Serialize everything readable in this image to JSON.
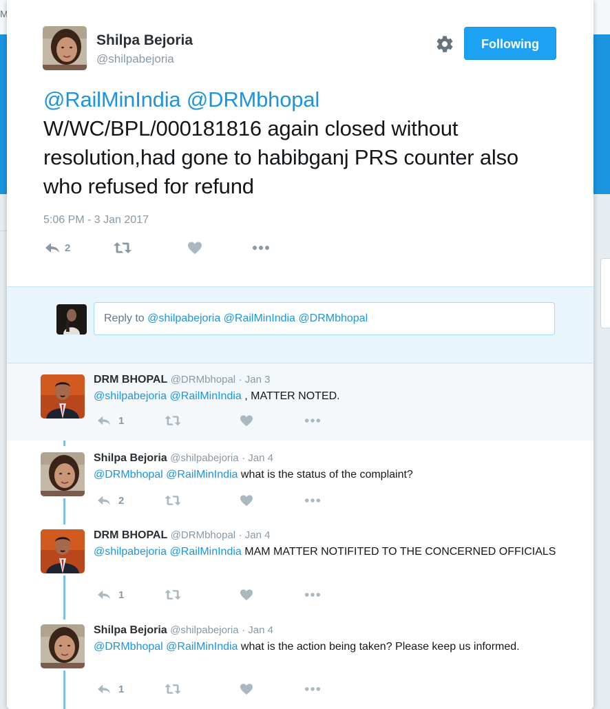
{
  "background": {
    "top_fragment": "M"
  },
  "main_tweet": {
    "author_name": "Shilpa Bejoria",
    "author_handle": "@shilpabejoria",
    "follow_label": "Following",
    "mention1": "@RailMinIndia",
    "mention2": "@DRMbhopal",
    "body": "W/WC/BPL/000181816 again closed without resolution,had gone to habibganj PRS counter also who refused for refund",
    "timestamp": "5:06 PM - 3 Jan 2017",
    "reply_count": "2"
  },
  "reply_box": {
    "prefix": "Reply to ",
    "mentions": "@shilpabejoria @RailMinIndia @DRMbhopal"
  },
  "replies": [
    {
      "name": "DRM BHOPAL",
      "handle": "@DRMbhopal",
      "date": "· Jan 3",
      "mentions": "@shilpabejoria @RailMinIndia",
      "text": " , MATTER NOTED.",
      "reply_count": "1"
    },
    {
      "name": "Shilpa Bejoria",
      "handle": "@shilpabejoria",
      "date": "· Jan 4",
      "mentions": "@DRMbhopal @RailMinIndia",
      "text": " what is the status of the complaint?",
      "reply_count": "2"
    },
    {
      "name": "DRM BHOPAL",
      "handle": "@DRMbhopal",
      "date": "· Jan 4",
      "mentions": "@shilpabejoria @RailMinIndia",
      "text": " MAM MATTER NOTIFITED TO THE CONCERNED OFFICIALS",
      "reply_count": "1"
    },
    {
      "name": "Shilpa Bejoria",
      "handle": "@shilpabejoria",
      "date": "· Jan 4",
      "mentions": "@DRMbhopal @RailMinIndia",
      "text": " what is the action being taken? Please keep us informed.",
      "reply_count": "1"
    }
  ],
  "colors": {
    "accent": "#1da1f2",
    "mention": "#1b95e0",
    "muted": "#8899a6",
    "thread_line": "#7ec0e8"
  },
  "icons": [
    "gear-icon",
    "reply-icon",
    "retweet-icon",
    "like-icon",
    "more-icon"
  ]
}
